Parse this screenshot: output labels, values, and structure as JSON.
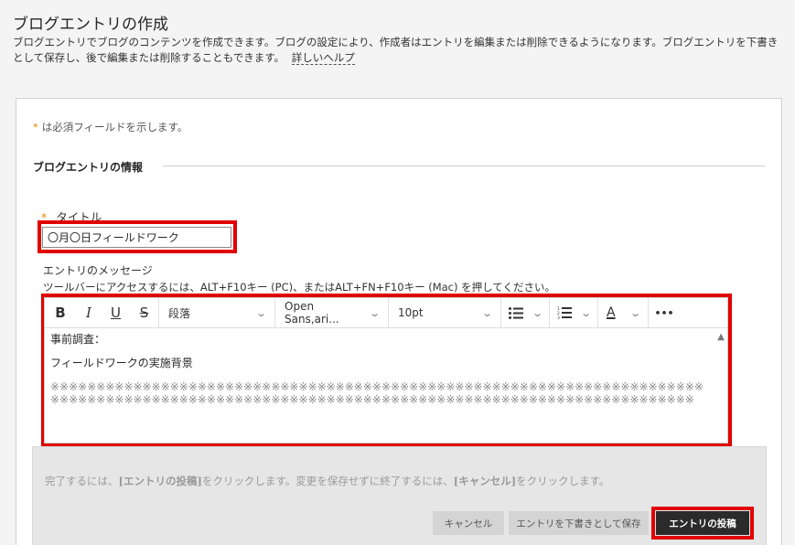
{
  "page": {
    "title": "ブログエントリの作成",
    "description": "ブログエントリでブログのコンテンツを作成できます。ブログの設定により、作成者はエントリを編集または削除できるようになります。ブログエントリを下書きとして保存し、後で編集または削除することもできます。",
    "help_link": "詳しいヘルプ"
  },
  "form": {
    "required_note": "は必須フィールドを示します。",
    "section_title": "ブログエントリの情報",
    "title_label": "タイトル",
    "title_value": "〇月〇日フィールドワーク",
    "message_label": "エントリのメッセージ",
    "toolbar_hint": "ツールバーにアクセスするには、ALT+F10キー (PC)、またはALT+FN+F10キー (Mac) を押してください。"
  },
  "editor": {
    "toolbar": {
      "bold": "B",
      "italic": "I",
      "underline": "U",
      "strike": "S",
      "paragraph": "段落",
      "font": "Open Sans,ari...",
      "size": "10pt",
      "text_color": "A",
      "more": "•••"
    },
    "content": {
      "line1": "事前調査：",
      "line2": "フィールドワークの実施背景",
      "marks1": "※※※※※※※※※※※※※※※※※※※※※※※※※※※※※※※※※※※※※※※※※※※※※※※※※※※※※※※※※※※※※※※※※※※※※※※",
      "marks2": "※※※※※※※※※※※※※※※※※※※※※※※※※※※※※※※※※※※※※※※※※※※※※※※※※※※※※※※※※※※※※※※※※※※※※※"
    }
  },
  "footer": {
    "note_pre": "完了するには、",
    "note_post_label": "[エントリの投稿]",
    "note_mid": "をクリックします。変更を保存せずに終了するには、",
    "note_cancel_label": "[キャンセル]",
    "note_end": "をクリックします。",
    "cancel_button": "キャンセル",
    "draft_button": "エントリを下書きとして保存",
    "post_button": "エントリの投稿"
  },
  "colors": {
    "highlight": "#e00000",
    "required_star": "#e08a00",
    "primary_button": "#2b2b2b"
  },
  "icons": [
    "bullet-list-icon",
    "numbered-list-icon",
    "chevron-down-icon",
    "more-icon",
    "scroll-up-icon"
  ]
}
